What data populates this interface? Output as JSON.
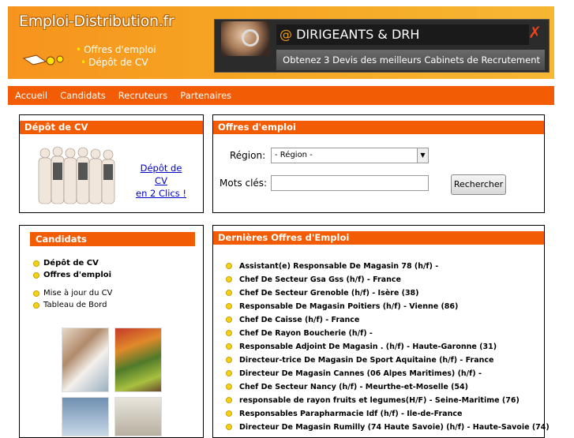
{
  "header": {
    "logo_text": "Emploi-Distribution.fr",
    "logo_links": [
      "Offres d'emploi",
      "Dépôt de CV"
    ],
    "banner_at": "@",
    "banner_title": "DIRIGEANTS & DRH",
    "banner_subtitle": "Obtenez 3 Devis des meilleurs Cabinets de Recrutement"
  },
  "nav": [
    "Accueil",
    "Candidats",
    "Recruteurs",
    "Partenaires"
  ],
  "cv_panel": {
    "title": "Dépôt de CV",
    "link_line1": "Dépôt de CV",
    "link_line2": "en 2 Clics !"
  },
  "offers_panel": {
    "title": "Offres d'emploi",
    "region_label": "Région:",
    "region_selected": "- Région -",
    "keywords_label": "Mots clés:",
    "keywords_value": "",
    "search_button": "Rechercher"
  },
  "candidates_panel": {
    "title": "Candidats",
    "primary_items": [
      "Dépôt de CV",
      "Offres d'emploi"
    ],
    "secondary_items": [
      "Mise à jour du CV",
      "Tableau de Bord"
    ]
  },
  "latest_offers": {
    "title": "Dernières Offres d'Emploi",
    "items": [
      "Assistant(e) Responsable De Magasin 78 (h/f) -",
      "Chef De Secteur Gsa Gss (h/f) - France",
      "Chef De Secteur Grenoble (h/f) - Isère (38)",
      "Responsable De Magasin Poitiers (h/f) - Vienne (86)",
      "Chef De Caisse (h/f) - France",
      "Chef De Rayon Boucherie (h/f) -",
      "Responsable Adjoint De Magasin . (h/f) - Haute-Garonne (31)",
      "Directeur-trice De Magasin De Sport Aquitaine (h/f) - France",
      "Directeur De Magasin Cannes (06 Alpes Maritimes) (h/f) -",
      "Chef De Secteur Nancy (h/f) - Meurthe-et-Moselle (54)",
      "responsable de rayon fruits et legumes(H/F) - Seine-Maritime (76)",
      "Responsables Parapharmacie Idf (h/f) - Ile-de-France",
      "Directeur De Magasin Rumilly (74 Haute Savoie) (h/f) - Haute-Savoie (74)"
    ]
  }
}
